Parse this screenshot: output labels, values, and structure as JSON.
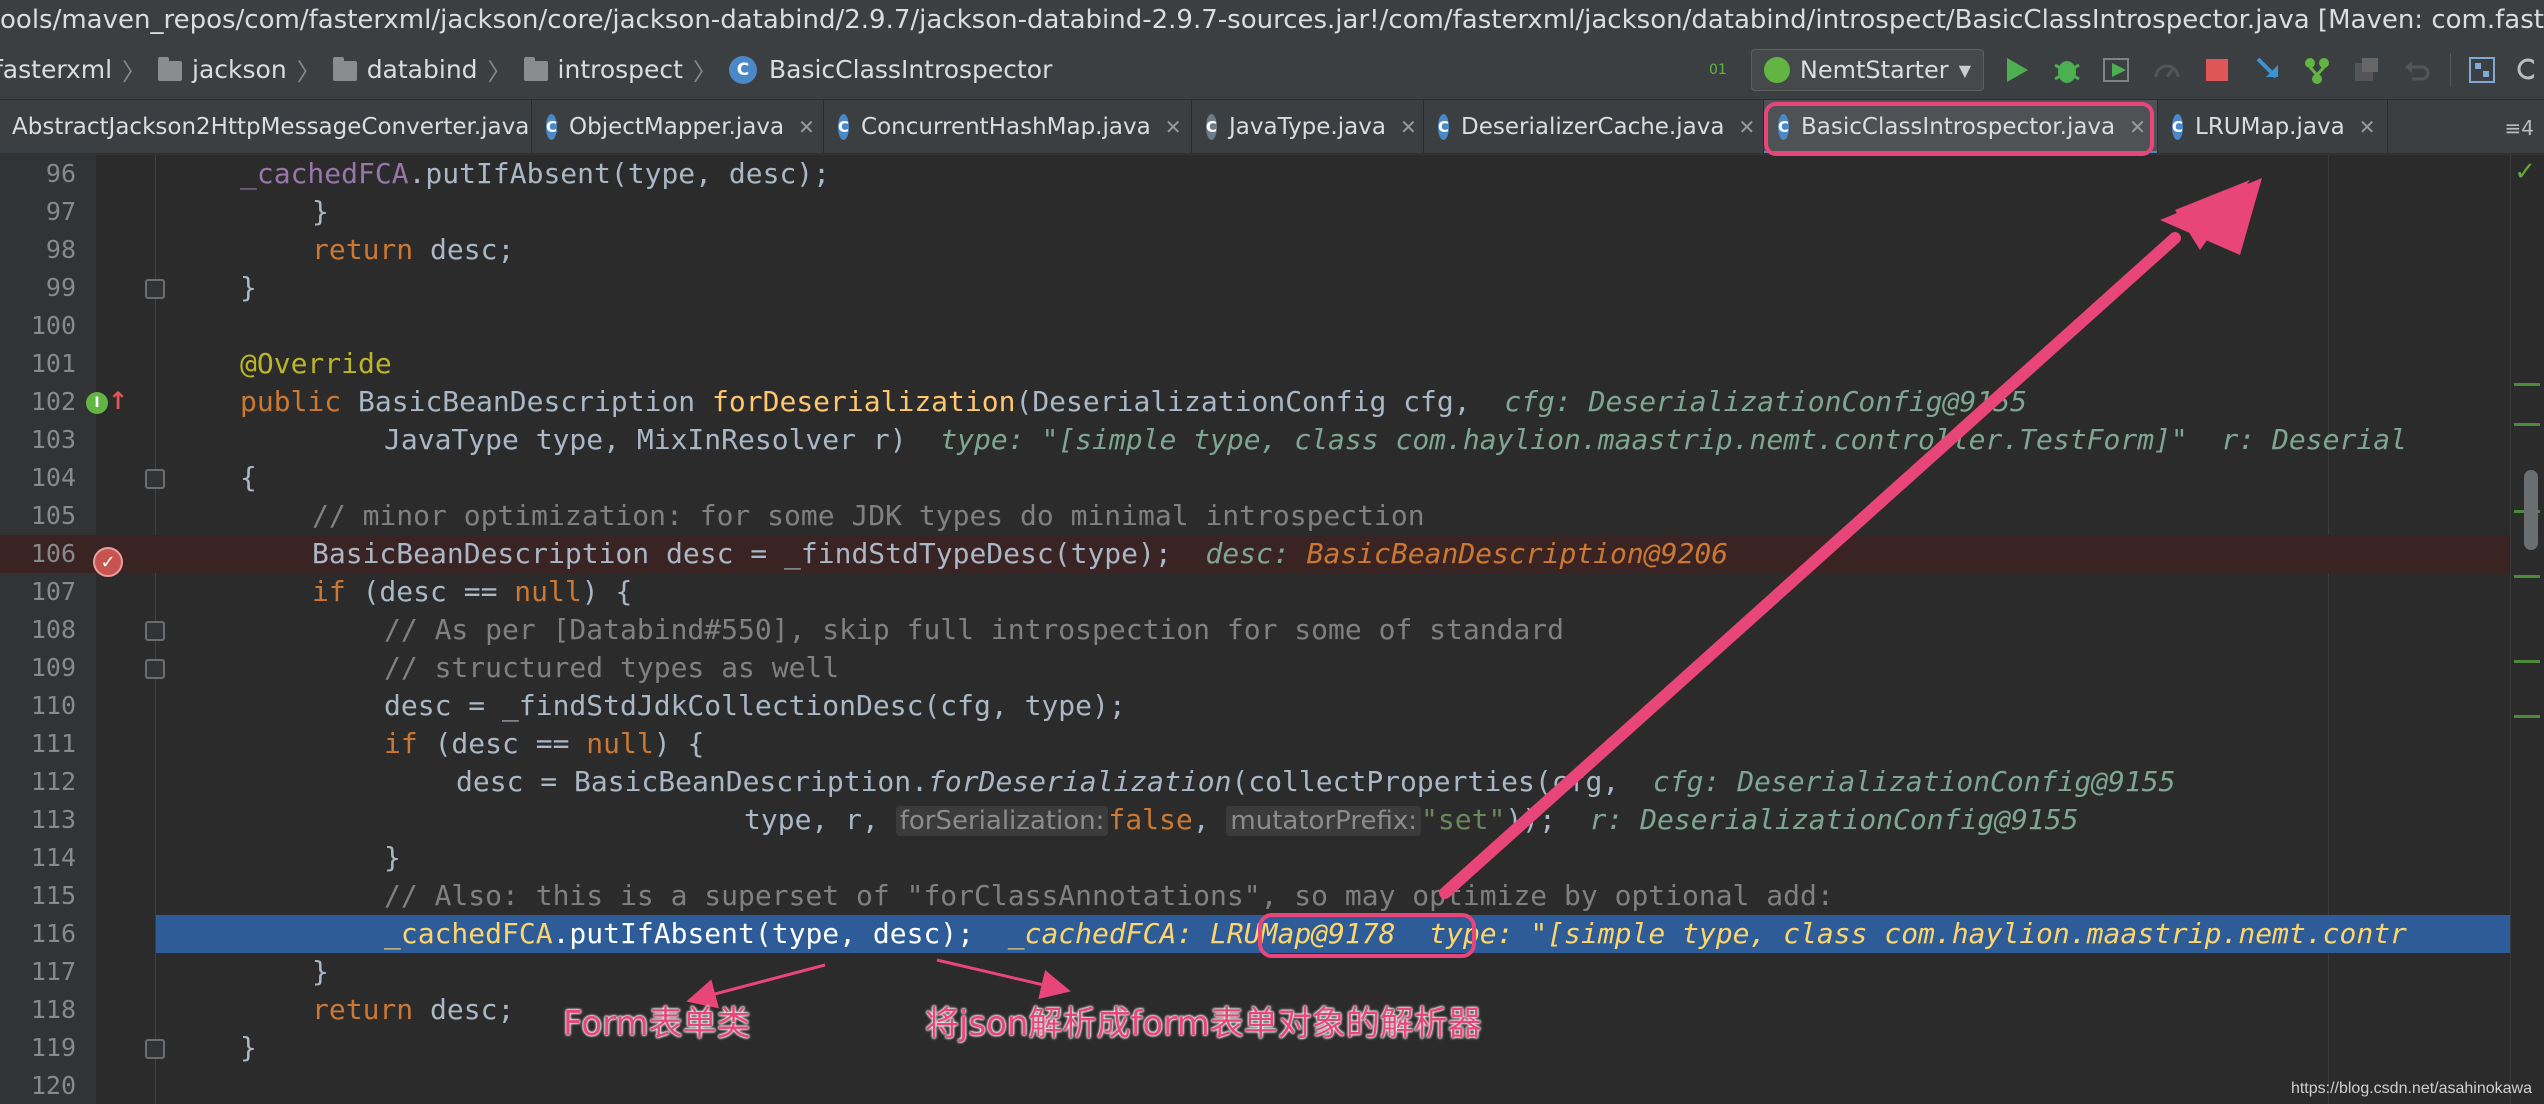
{
  "window": {
    "title": "ools/maven_repos/com/fasterxml/jackson/core/jackson-databind/2.9.7/jackson-databind-2.9.7-sources.jar!/com/fasterxml/jackson/databind/introspect/BasicClassIntrospector.java [Maven: com.fasterxml.jackson"
  },
  "breadcrumb": {
    "items": [
      "fasterxml",
      "jackson",
      "databind",
      "introspect"
    ],
    "current": "BasicClassIntrospector",
    "class_icon_letter": "C"
  },
  "toolbar": {
    "run_config_label": "NemtStarter",
    "sort_badge": "01"
  },
  "tabs": [
    {
      "label": "AbstractJackson2HttpMessageConverter.java",
      "active": false
    },
    {
      "label": "ObjectMapper.java",
      "active": false
    },
    {
      "label": "ConcurrentHashMap.java",
      "active": false
    },
    {
      "label": "JavaType.java",
      "active": false
    },
    {
      "label": "DeserializerCache.java",
      "active": false
    },
    {
      "label": "BasicClassIntrospector.java",
      "active": true
    },
    {
      "label": "LRUMap.java",
      "active": false
    }
  ],
  "tab_overflow": "≡4",
  "editor": {
    "line_numbers": [
      "96",
      "97",
      "98",
      "99",
      "100",
      "101",
      "102",
      "103",
      "104",
      "105",
      "106",
      "107",
      "108",
      "109",
      "110",
      "111",
      "112",
      "113",
      "114",
      "115",
      "116",
      "117",
      "118",
      "119",
      "120"
    ],
    "lines": {
      "l96": {
        "field": "_cachedFCA",
        "rest": ".putIfAbsent(type, desc);"
      },
      "l97": {
        "text": "}"
      },
      "l98": {
        "kw": "return",
        "rest": " desc;"
      },
      "l99": {
        "text": "}"
      },
      "l101": {
        "ann": "@Override"
      },
      "l102": {
        "kw": "public",
        "type": " BasicBeanDescription ",
        "fn": "forDeserialization",
        "rest": "(DeserializationConfig cfg,",
        "dbg": "cfg: DeserializationConfig@9155"
      },
      "l103": {
        "text": "JavaType type, MixInResolver r)",
        "dbg": "type: \"[simple type, class com.haylion.maastrip.nemt.controller.TestForm]\"  r: Deserial"
      },
      "l104": {
        "text": "{"
      },
      "l105": {
        "cmt": "// minor optimization: for some JDK types do minimal introspection"
      },
      "l106": {
        "text": "BasicBeanDescription desc = _findStdTypeDesc(type);",
        "dbg_name": "desc:",
        "dbg_val": "BasicBeanDescription@9206"
      },
      "l107": {
        "kw": "if",
        "pre": " (desc == ",
        "kw2": "null",
        "rest": ") {"
      },
      "l108": {
        "cmt": "// As per [Databind#550], skip full introspection for some of standard"
      },
      "l109": {
        "cmt": "// structured types as well"
      },
      "l110": {
        "text": "desc = _findStdJdkCollectionDesc(cfg, type);"
      },
      "l111": {
        "kw": "if",
        "pre": " (desc == ",
        "kw2": "null",
        "rest": ") {"
      },
      "l112": {
        "pre": "desc = BasicBeanDescription.",
        "fn_italic": "forDeserialization",
        "rest": "(collectProperties(cfg,",
        "dbg": "cfg: DeserializationConfig@9155"
      },
      "l113": {
        "pre": "type, r, ",
        "hint1": "forSerialization:",
        "kw": "false",
        "sep": ", ",
        "hint2": "mutatorPrefix:",
        "str": "\"set\"",
        "rest": "));",
        "dbg": "r: DeserializationConfig@9155"
      },
      "l114": {
        "text": "}"
      },
      "l115": {
        "cmt": "// Also: this is a superset of \"forClassAnnotations\", so may optimize by optional add:"
      },
      "l116": {
        "field": "_cachedFCA",
        "rest": ".putIfAbsent(type, desc);",
        "dbg_name": "_cachedFCA:",
        "dbg_val": "LRUMap@9178",
        "dbg_tail": "type: \"[simple type, class com.haylion.maastrip.nemt.contr"
      },
      "l117": {
        "text": "}"
      },
      "l118": {
        "kw": "return",
        "rest": " desc;"
      },
      "l119": {
        "text": "}"
      }
    }
  },
  "annotations": {
    "form_label": "Form表单类",
    "parser_label": "将json解析成form表单对象的解析器"
  },
  "watermark": "https://blog.csdn.net/asahinokawa",
  "colors": {
    "accent": "#4a88c7",
    "annotation": "#e8457a",
    "breakpoint": "#c75450",
    "current_line": "#2d5c99"
  }
}
